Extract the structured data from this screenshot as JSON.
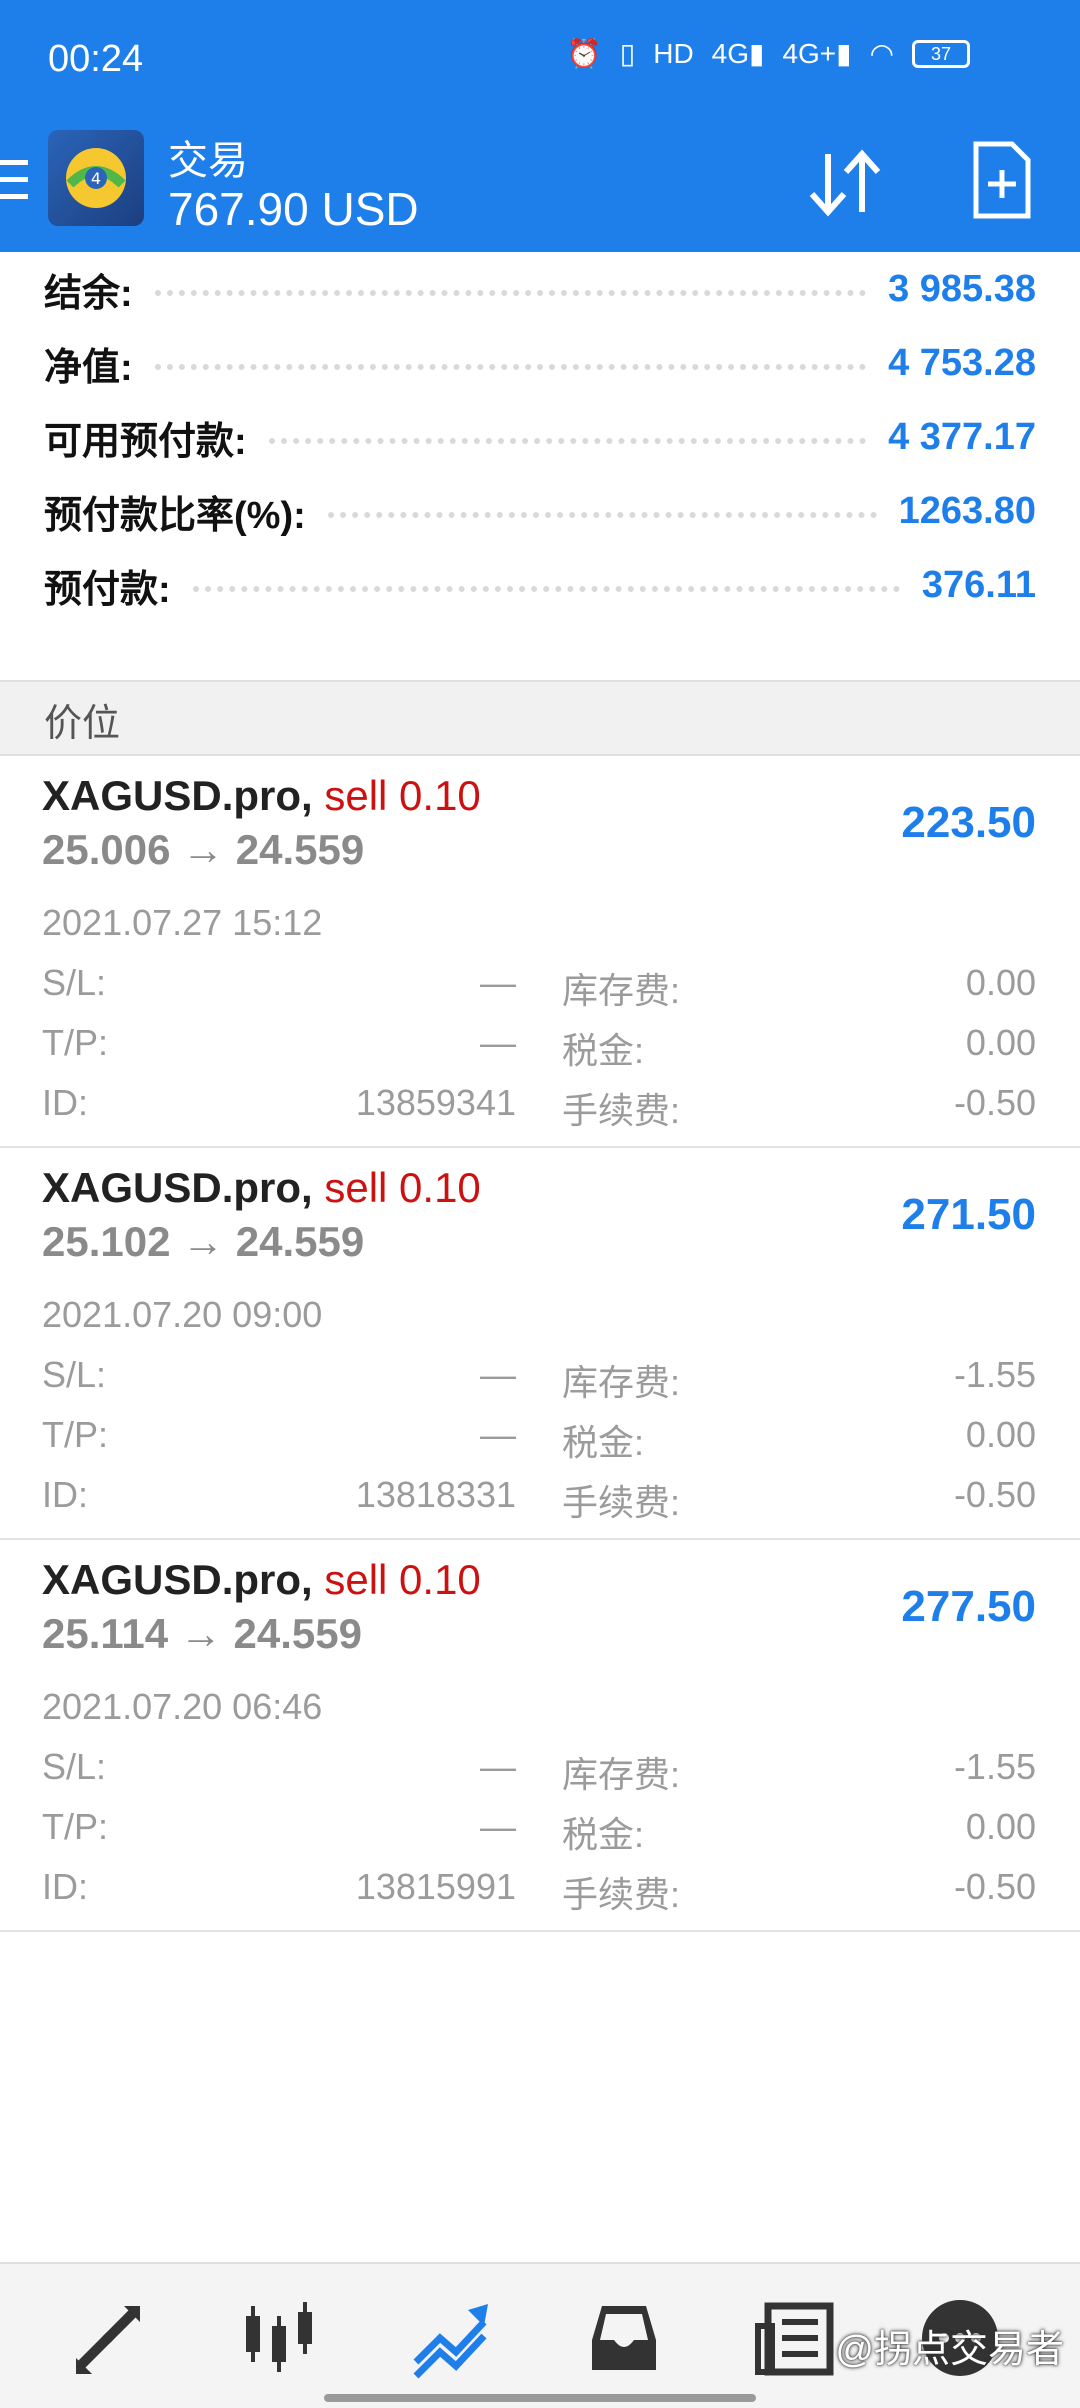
{
  "status_bar": {
    "time": "00:24",
    "battery": "37",
    "icons": [
      "alarm-icon",
      "vibrate-icon",
      "hd-icon",
      "signal-4g-icon",
      "signal-4g-plus-icon",
      "wifi-icon",
      "battery-icon"
    ]
  },
  "app_bar": {
    "title": "交易",
    "balance_display": "767.90 USD",
    "icons": [
      "menu-icon",
      "app-logo",
      "sort-icon",
      "new-order-icon"
    ]
  },
  "summary": [
    {
      "label": "结余:",
      "value": "3 985.38"
    },
    {
      "label": "净值:",
      "value": "4 753.28"
    },
    {
      "label": "可用预付款:",
      "value": "4 377.17"
    },
    {
      "label": "预付款比率(%):",
      "value": "1263.80"
    },
    {
      "label": "预付款:",
      "value": "376.11"
    }
  ],
  "section_title": "价位",
  "orders": [
    {
      "symbol": "XAGUSD.pro,",
      "side": "sell 0.10",
      "prices": "25.006 → 24.559",
      "profit": "223.50",
      "datetime": "2021.07.27 15:12",
      "sl_label": "S/L:",
      "sl_value": "—",
      "tp_label": "T/P:",
      "tp_value": "—",
      "id_label": "ID:",
      "id_value": "13859341",
      "swap_label": "库存费:",
      "swap_value": "0.00",
      "tax_label": "税金:",
      "tax_value": "0.00",
      "fee_label": "手续费:",
      "fee_value": "-0.50"
    },
    {
      "symbol": "XAGUSD.pro,",
      "side": "sell 0.10",
      "prices": "25.102 → 24.559",
      "profit": "271.50",
      "datetime": "2021.07.20 09:00",
      "sl_label": "S/L:",
      "sl_value": "—",
      "tp_label": "T/P:",
      "tp_value": "—",
      "id_label": "ID:",
      "id_value": "13818331",
      "swap_label": "库存费:",
      "swap_value": "-1.55",
      "tax_label": "税金:",
      "tax_value": "0.00",
      "fee_label": "手续费:",
      "fee_value": "-0.50"
    },
    {
      "symbol": "XAGUSD.pro,",
      "side": "sell 0.10",
      "prices": "25.114 → 24.559",
      "profit": "277.50",
      "datetime": "2021.07.20 06:46",
      "sl_label": "S/L:",
      "sl_value": "—",
      "tp_label": "T/P:",
      "tp_value": "—",
      "id_label": "ID:",
      "id_value": "13815991",
      "swap_label": "库存费:",
      "swap_value": "-1.55",
      "tax_label": "税金:",
      "tax_value": "0.00",
      "fee_label": "手续费:",
      "fee_value": "-0.50"
    }
  ],
  "bottom_nav": [
    "quotes-icon",
    "chart-icon",
    "trade-icon",
    "history-icon",
    "news-icon",
    "messages-icon"
  ],
  "watermark": "@拐点交易者",
  "colors": {
    "primary": "#1e7fea",
    "sell": "#cc1111",
    "muted": "#9b9b9b"
  }
}
